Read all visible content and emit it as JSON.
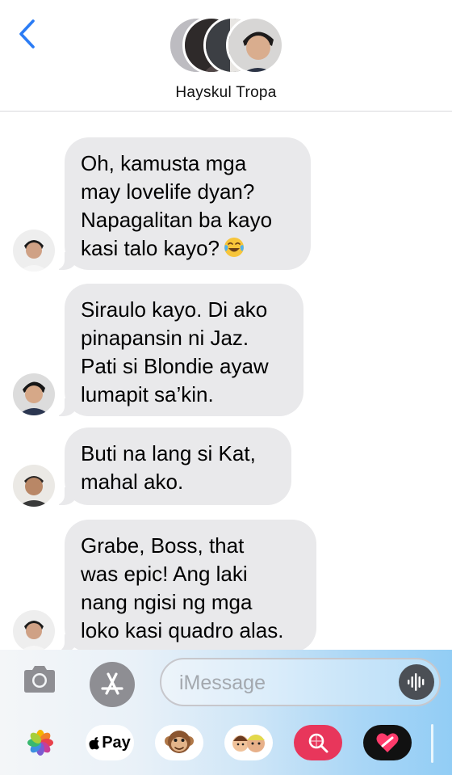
{
  "header": {
    "group_name": "Hayskul Tropa",
    "back_icon": "chevron-left-icon",
    "accent": "#2b7cf5"
  },
  "messages": [
    {
      "lines": [
        "Oh, kamusta mga",
        "may lovelife dyan?",
        "Napagalitan ba kayo",
        "kasi talo kayo?"
      ],
      "emoji": "face-with-tears-of-joy"
    },
    {
      "lines": [
        "Siraulo kayo. Di ako",
        "pinapansin ni Jaz.",
        "Pati si Blondie ayaw",
        "lumapit sa’kin."
      ]
    },
    {
      "lines": [
        "Buti na lang si Kat,",
        "mahal ako."
      ]
    },
    {
      "lines": [
        "Grabe, Boss, that",
        "was epic! Ang laki",
        "nang ngisi ng mga",
        "loko kasi quadro alas."
      ]
    }
  ],
  "composer": {
    "placeholder": "iMessage",
    "value": "",
    "camera_icon": "camera-icon",
    "apps_icon": "app-store-icon",
    "audio_icon": "audio-waveform-icon"
  },
  "app_strip": {
    "apple_pay_label": "Pay",
    "items": [
      "photos-icon",
      "apple-pay-icon",
      "monkey-animoji-icon",
      "memoji-icon",
      "image-search-icon",
      "heart-icon"
    ]
  },
  "colors": {
    "bubble_received": "#e9e9eb",
    "header_border": "#d9d9dc"
  }
}
